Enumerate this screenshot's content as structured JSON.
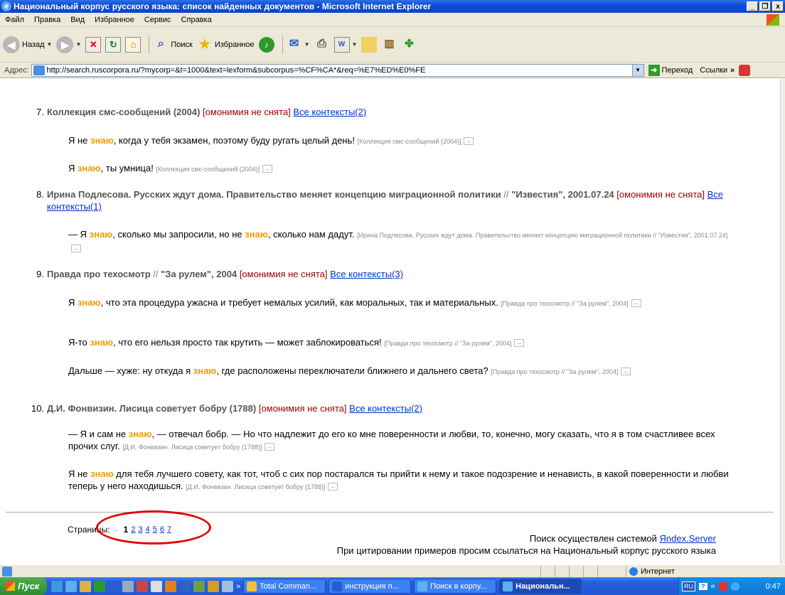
{
  "window": {
    "title": "Национальный корпус русского языка: список найденных документов - Microsoft Internet Explorer",
    "controls": [
      "_",
      "❐",
      "x"
    ]
  },
  "menu": [
    "Файл",
    "Правка",
    "Вид",
    "Избранное",
    "Сервис",
    "Справка"
  ],
  "toolbar": {
    "back_label": "Назад",
    "search_label": "Поиск",
    "favorites_label": "Избранное"
  },
  "address": {
    "label": "Адрес:",
    "url": "http://search.ruscorpora.ru/?mycorp=&t=1000&text=lexform&subcorpus=%CF%CA*&req=%E7%ED%E0%FE",
    "go_label": "Переход",
    "links_label": "Ссылки"
  },
  "results": {
    "omonimia_label": "[омонимия не снята]",
    "docs": [
      {
        "num": "7.",
        "title": "Коллекция смс-сообщений (2004)",
        "contexts": "Все контексты(2)",
        "snippets": [
          {
            "before": "Я не ",
            "kw": "знаю",
            "after": ", когда у тебя экзамен, поэтому буду ругать целый день! ",
            "source": "[Коллекция смс-сообщений (2004)]"
          },
          {
            "before": "Я ",
            "kw": "знаю",
            "after": ", ты умница! ",
            "source": "[Коллекция смс-сообщений (2004)]"
          }
        ]
      },
      {
        "num": "8.",
        "title": "Ирина Подлесова. Русских ждут дома. Правительство меняет концепцию миграционной политики",
        "title_sep": "//",
        "title_rest": "\"Известия\", 2001.07.24",
        "contexts": "Все контексты(1)",
        "snippets": [
          {
            "before": "— Я ",
            "kw": "знаю",
            "mid": ", сколько мы запросили, но не ",
            "kw2": "знаю",
            "after": ", сколько нам дадут. ",
            "source": "[Ирина Подлесова. Русских ждут дома. Правительство меняет концепцию миграционной политики // \"Известия\", 2001.07.24]"
          }
        ]
      },
      {
        "num": "9.",
        "title": "Правда про техосмотр",
        "title_sep": "//",
        "title_rest": "\"За рулем\", 2004",
        "contexts": "Все контексты(3)",
        "snippets": [
          {
            "before": "Я ",
            "kw": "знаю",
            "after": ", что эта процедура ужасна и требует немалых усилий, как моральных, так и материальных. ",
            "source": "[Правда про техосмотр // \"За рулем\", 2004]"
          },
          {
            "before": "Я-то ",
            "kw": "знаю",
            "after": ", что его нельзя просто так крутить — может заблокироваться! ",
            "source": "[Правда про техосмотр // \"За рулем\", 2004]"
          },
          {
            "before": "Дальше — хуже: ну откуда я ",
            "kw": "знаю",
            "after": ", где расположены переключатели ближнего и дальнего света? ",
            "source": "[Правда про техосмотр // \"За рулем\", 2004]"
          }
        ]
      },
      {
        "num": "10.",
        "title": "Д.И. Фонвизин. Лисица советует бобру (1788)",
        "contexts": "Все контексты(2)",
        "snippets": [
          {
            "before": "— Я и сам не ",
            "kw": "знаю",
            "after": ", — отвечал бобр. — Но что надлежит до его ко мне поверенности и любви, то, конечно, могу сказать, что я в том счастливее всех прочих слуг. ",
            "source": "[Д.И. Фонвизин. Лисица советует бобру (1788)]"
          },
          {
            "before": "Я не ",
            "kw": "знаю",
            "after": " для тебя лучшего совету, как тот, чтоб с сих пор постарался ты прийти к нему и такое подозрение и ненависть, в какой поверенности и любви теперь у него находишься. ",
            "source": "[Д.И. Фонвизин. Лисица советует бобру (1788)]"
          }
        ]
      }
    ],
    "expand_label": "↔"
  },
  "pagination": {
    "label": "Страницы:",
    "prev": "←",
    "current": "1",
    "pages": [
      "2",
      "3",
      "4",
      "5",
      "6",
      "7"
    ]
  },
  "footer": {
    "search_by": "Поиск осуществлен системой ",
    "yandex": "Яndex.Server",
    "citation": "При цитировании примеров просим ссылаться на Национальный корпус русского языка"
  },
  "status": {
    "zone": "Интернет"
  },
  "taskbar": {
    "start": "Пуск",
    "more": "»",
    "tasks": [
      "Total Comman...",
      "инструкция п...",
      "Поиск в корпу...",
      "Национальн..."
    ],
    "active_index": 3,
    "lang": "RU",
    "help": "?",
    "chevron": "«",
    "clock": "0:47"
  }
}
